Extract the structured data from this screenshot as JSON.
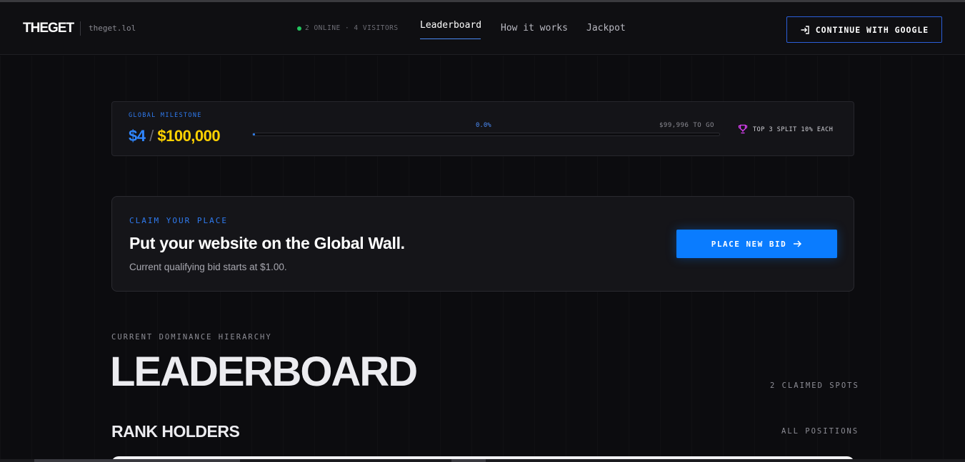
{
  "header": {
    "logo": "THEGET",
    "domain": "theget.lol",
    "online": "2 ONLINE · 4 VISITORS",
    "nav": [
      {
        "label": "Leaderboard",
        "active": true
      },
      {
        "label": "How it works",
        "active": false
      },
      {
        "label": "Jackpot",
        "active": false
      }
    ],
    "google_button": "CONTINUE WITH GOOGLE"
  },
  "milestone": {
    "label": "GLOBAL MILESTONE",
    "current": "$4",
    "separator": "/",
    "goal": "$100,000",
    "percent_label": "0.0%",
    "progress": 4e-05,
    "to_go": "$99,996 TO GO",
    "split_label": "TOP 3 SPLIT 10% EACH"
  },
  "claim": {
    "label": "CLAIM YOUR PLACE",
    "title": "Put your website on the Global Wall.",
    "subtitle": "Current qualifying bid starts at $1.00.",
    "button": "PLACE NEW BID"
  },
  "leaderboard": {
    "eyebrow": "CURRENT DOMINANCE HIERARCHY",
    "title": "LEADERBOARD",
    "claimed": "2 CLAIMED SPOTS",
    "section_title": "RANK HOLDERS",
    "all_positions": "ALL POSITIONS"
  },
  "icons": {
    "login": "login-arrow-icon",
    "trophy": "trophy-icon",
    "arrow": "arrow-right-icon"
  },
  "colors": {
    "accent": "#0a7cff",
    "goal": "#ffd200",
    "online": "#22c55e",
    "trophy": "#e040fb"
  }
}
